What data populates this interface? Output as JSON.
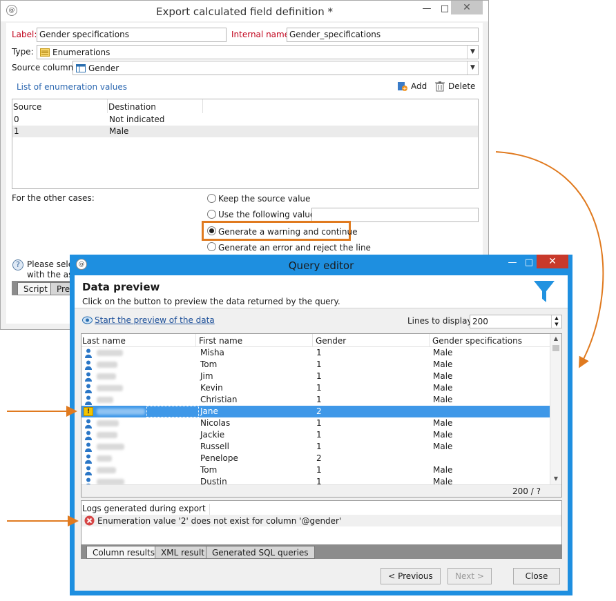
{
  "export_window": {
    "title": "Export calculated field definition *",
    "label_caption": "Label:",
    "label_value": "Gender specifications",
    "internal_name_caption": "Internal name:",
    "internal_name_value": "Gender_specifications",
    "type_caption": "Type:",
    "type_value": "Enumerations",
    "source_column_caption": "Source column:",
    "source_column_value": "Gender",
    "enum_section_title": "List of enumeration values",
    "add_label": "Add",
    "delete_label": "Delete",
    "enum_table": {
      "headers": [
        "Source",
        "Destination"
      ],
      "rows": [
        {
          "source": "0",
          "destination": "Not indicated"
        },
        {
          "source": "1",
          "destination": "Male"
        }
      ]
    },
    "other_cases_caption": "For the other cases:",
    "options": [
      "Keep the source value",
      "Use the following value:",
      "Generate a warning and continue",
      "Generate an error and reject the line"
    ],
    "selected_option": "Generate a warning and continue",
    "following_value": "",
    "help_text_line1": "Please select",
    "help_text_line2": "with the ass",
    "tabs": [
      "Script",
      "Prev"
    ]
  },
  "query_editor": {
    "title": "Query editor",
    "header_title": "Data preview",
    "header_subtitle": "Click on the button to preview the data returned by the query.",
    "start_preview_link": "Start the preview of the data",
    "lines_caption": "Lines to display:",
    "lines_value": "200",
    "columns": [
      "Last name",
      "First name",
      "Gender",
      "Gender specifications"
    ],
    "rows": [
      {
        "first": "Misha",
        "gender": "1",
        "spec": "Male",
        "warning": false
      },
      {
        "first": "Tom",
        "gender": "1",
        "spec": "Male",
        "warning": false
      },
      {
        "first": "Jim",
        "gender": "1",
        "spec": "Male",
        "warning": false
      },
      {
        "first": "Kevin",
        "gender": "1",
        "spec": "Male",
        "warning": false
      },
      {
        "first": "Christian",
        "gender": "1",
        "spec": "Male",
        "warning": false
      },
      {
        "first": "Jane",
        "gender": "2",
        "spec": "",
        "warning": true
      },
      {
        "first": "Nicolas",
        "gender": "1",
        "spec": "Male",
        "warning": false
      },
      {
        "first": "Jackie",
        "gender": "1",
        "spec": "Male",
        "warning": false
      },
      {
        "first": "Russell",
        "gender": "1",
        "spec": "Male",
        "warning": false
      },
      {
        "first": "Penelope",
        "gender": "2",
        "spec": "",
        "warning": false
      },
      {
        "first": "Tom",
        "gender": "1",
        "spec": "Male",
        "warning": false
      },
      {
        "first": "Dustin",
        "gender": "1",
        "spec": "Male",
        "warning": false
      }
    ],
    "row_count": "200 / ?",
    "logs_title": "Logs generated during export",
    "log_message": "Enumeration value '2' does not exist for column '@gender'",
    "bottom_tabs": [
      "Column results",
      "XML result",
      "Generated SQL queries"
    ],
    "previous_label": "< Previous",
    "next_label": "Next >",
    "close_label": "Close"
  },
  "colors": {
    "accent_blue": "#1e8fe0",
    "selection": "#3f98e8",
    "highlight_orange": "#e07a1f",
    "required_red": "#c0001a",
    "link_blue": "#2b67b0"
  }
}
